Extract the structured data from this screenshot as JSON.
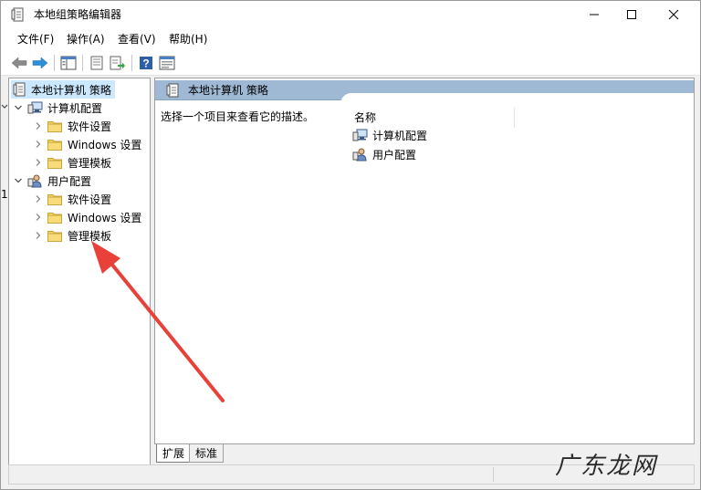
{
  "window": {
    "title": "本地组策略编辑器"
  },
  "menu": {
    "items": [
      {
        "label": "文件(F)"
      },
      {
        "label": "操作(A)"
      },
      {
        "label": "查看(V)"
      },
      {
        "label": "帮助(H)"
      }
    ]
  },
  "toolbar": {
    "icons": [
      "back-arrow-icon",
      "forward-arrow-icon",
      "show-hide-tree-icon",
      "properties-icon",
      "export-list-icon",
      "help-icon",
      "console-view-icon"
    ]
  },
  "tree": {
    "root": "本地计算机 策略",
    "computer": {
      "label": "计算机配置",
      "children": [
        {
          "label": "软件设置"
        },
        {
          "label": "Windows 设置"
        },
        {
          "label": "管理模板"
        }
      ]
    },
    "user": {
      "label": "用户配置",
      "children": [
        {
          "label": "软件设置"
        },
        {
          "label": "Windows 设置"
        },
        {
          "label": "管理模板"
        }
      ]
    }
  },
  "right_pane": {
    "header": "本地计算机 策略",
    "description": "选择一个项目来查看它的描述。",
    "column_name": "名称",
    "items": [
      {
        "label": "计算机配置"
      },
      {
        "label": "用户配置"
      }
    ]
  },
  "tabs": {
    "expanded": "扩展",
    "standard": "标准"
  },
  "edge": {
    "digit": "1"
  },
  "watermark": "广东龙网",
  "colors": {
    "selection": "#cce8ff",
    "header_bar": "#9fb8d3",
    "annotation_arrow": "#e8413a",
    "folder": "#e8c15a"
  }
}
